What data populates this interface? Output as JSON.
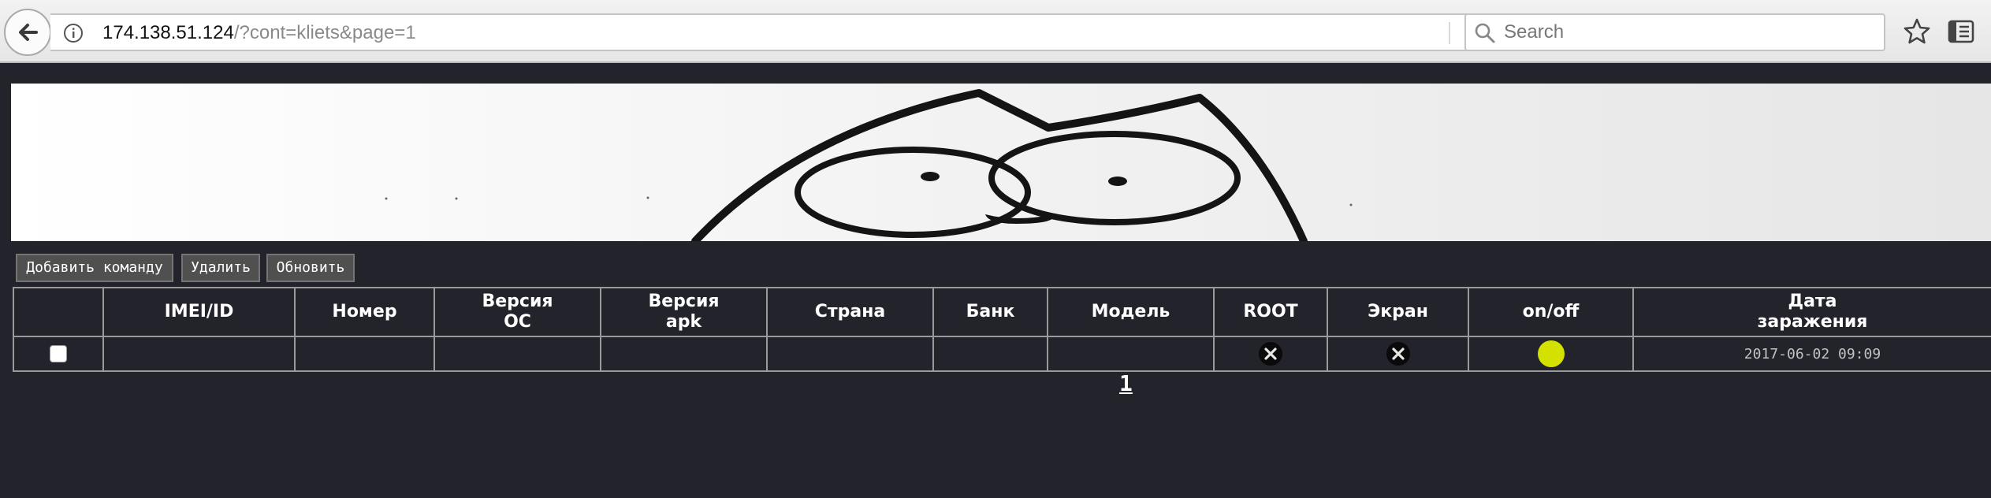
{
  "browser": {
    "url_host": "174.138.51.124",
    "url_path": "/?cont=kliets&page=1",
    "search_placeholder": "Search"
  },
  "toolbar": {
    "add_command": "Добавить команду",
    "delete": "Удалить",
    "refresh": "Обновить"
  },
  "table": {
    "columns": [
      "",
      "IMEI/ID",
      "Номер",
      "Версия ОС",
      "Версия apk",
      "Страна",
      "Банк",
      "Модель",
      "ROOT",
      "Экран",
      "on/off",
      "Дата заражения"
    ],
    "rows": [
      {
        "imei": "",
        "number": "",
        "os_version": "",
        "apk_version": "",
        "country": "",
        "bank": "",
        "model": "",
        "root": "x-circle-icon",
        "screen": "x-circle-icon",
        "status": "online-dot",
        "date": "2017-06-02 09:09"
      }
    ]
  },
  "pagination": {
    "current": "1"
  },
  "colors": {
    "page_bg": "#23232b",
    "status_dot": "#d4e000"
  }
}
